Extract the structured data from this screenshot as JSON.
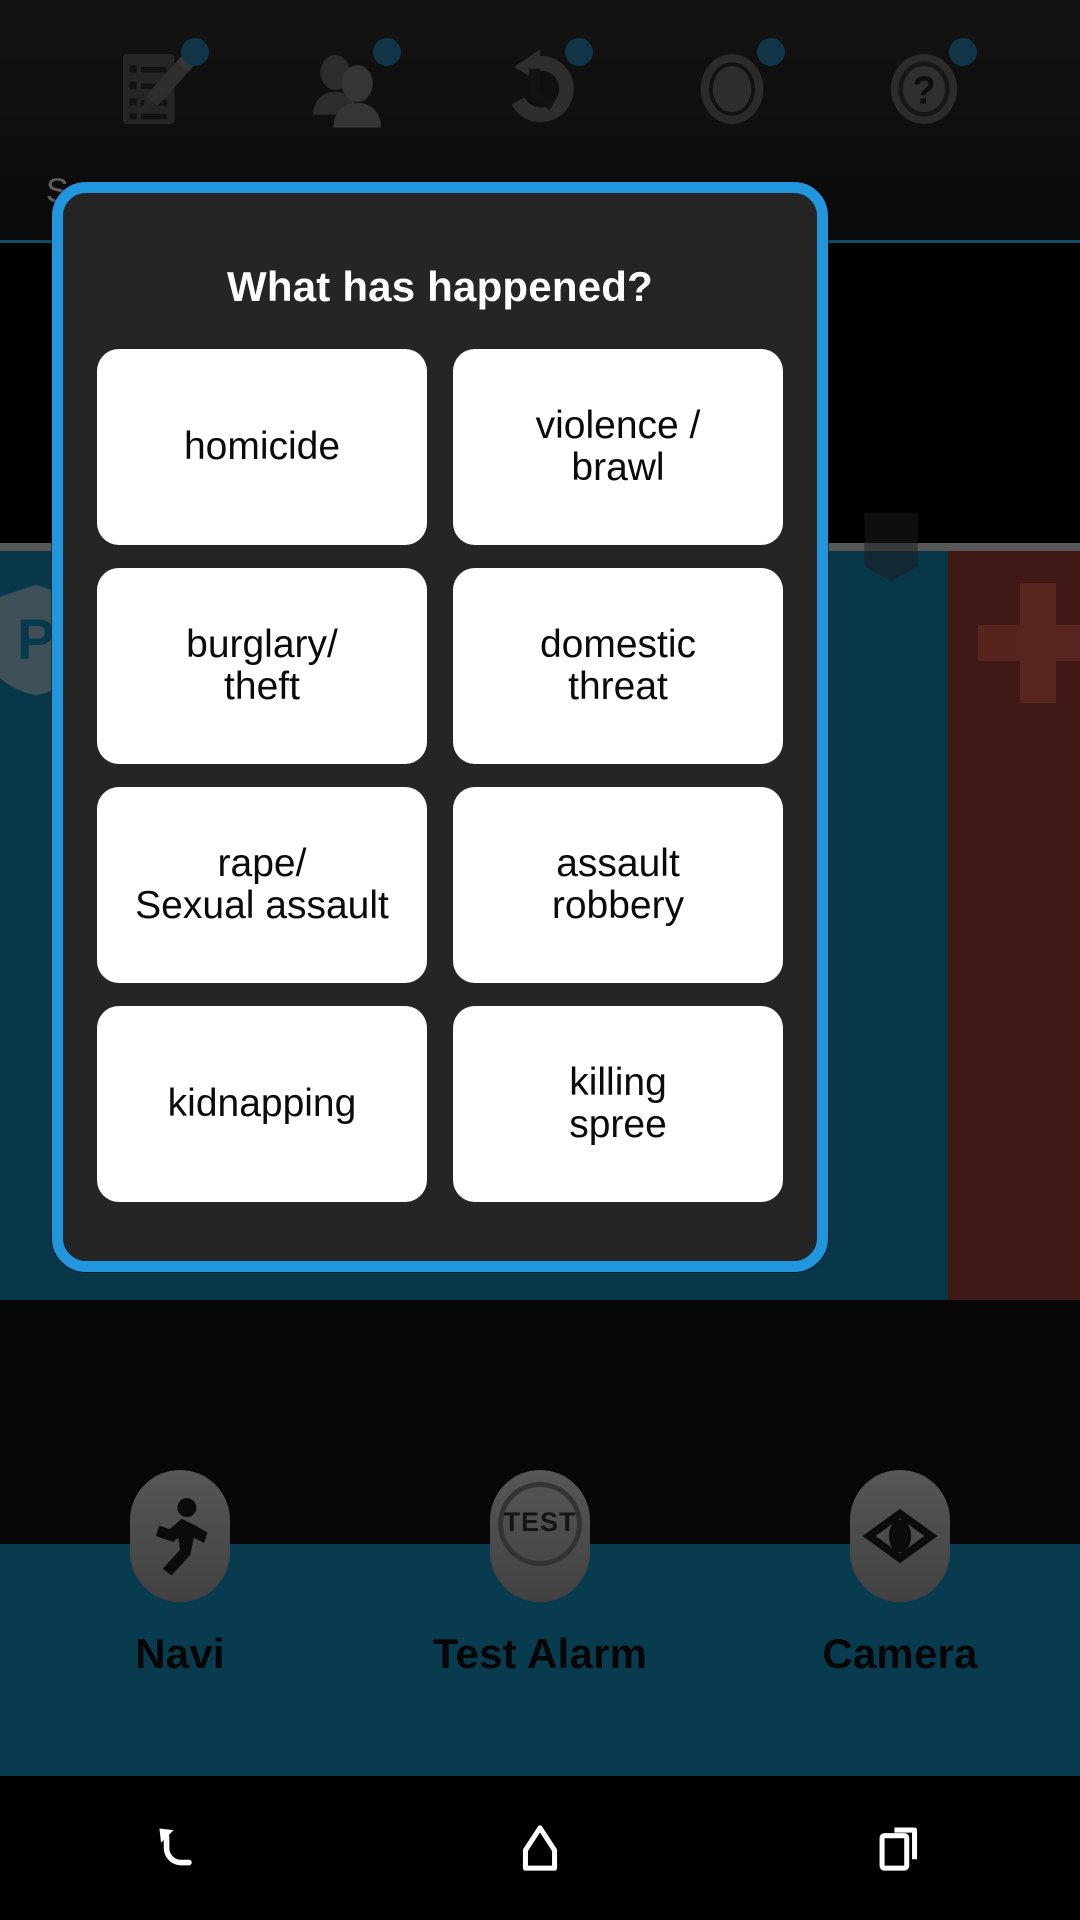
{
  "background": {
    "top_toolbar": [
      {
        "name": "form-edit-icon",
        "badge": true
      },
      {
        "name": "contacts-icon",
        "badge": true
      },
      {
        "name": "history-refresh-icon",
        "badge": true
      },
      {
        "name": "record-button-icon",
        "badge": true
      },
      {
        "name": "help-question-icon",
        "badge": true
      }
    ],
    "partial_label": "S",
    "bottom_bar": {
      "items": [
        {
          "label": "Navi",
          "icon": "running-person-icon"
        },
        {
          "label": "Test Alarm",
          "icon": "test-button-icon",
          "inner_text": "TEST"
        },
        {
          "label": "Camera",
          "icon": "eye-icon"
        }
      ]
    },
    "tiles": {
      "left_badge": "P",
      "right_badge": "cross-icon"
    }
  },
  "dialog": {
    "title": "What has happened?",
    "accent_color": "#2196dd",
    "background_color": "#252525",
    "options": [
      {
        "label": "homicide"
      },
      {
        "label": "violence /\nbrawl"
      },
      {
        "label": "burglary/\ntheft"
      },
      {
        "label": "domestic\nthreat"
      },
      {
        "label": "rape/\nSexual assault"
      },
      {
        "label": "assault\nrobbery"
      },
      {
        "label": "kidnapping"
      },
      {
        "label": "killing\nspree"
      }
    ]
  },
  "android_nav": {
    "buttons": [
      {
        "name": "back-icon"
      },
      {
        "name": "home-icon"
      },
      {
        "name": "recents-icon"
      }
    ]
  }
}
